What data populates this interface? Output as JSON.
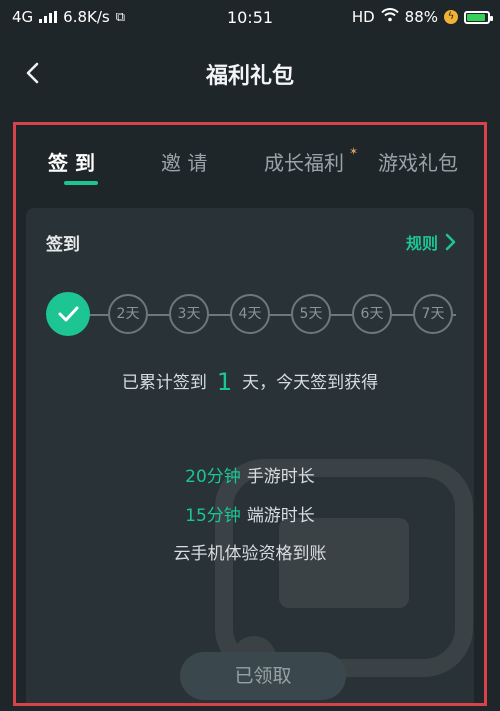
{
  "status_bar": {
    "network": "4G",
    "speed": "6.8K/s",
    "time": "10:51",
    "hd": "HD",
    "battery": "88%",
    "battery_level": 0.88
  },
  "header": {
    "title": "福利礼包"
  },
  "tabs": [
    {
      "label": "签 到",
      "active": true
    },
    {
      "label": "邀 请",
      "active": false
    },
    {
      "label": "成长福利",
      "active": false
    },
    {
      "label": "游戏礼包",
      "active": false
    }
  ],
  "signin": {
    "title": "签到",
    "rules_label": "规则",
    "days": [
      "2天",
      "3天",
      "4天",
      "5天",
      "6天",
      "7天"
    ],
    "summary_prefix": "已累计签到",
    "summary_count": "1",
    "summary_suffix": "天，今天签到获得",
    "rewards": [
      {
        "amount": "20分钟",
        "desc": "手游时长"
      },
      {
        "amount": "15分钟",
        "desc": "端游时长"
      }
    ],
    "extra_reward": "云手机体验资格到账",
    "claim_label": "已领取"
  },
  "colors": {
    "accent": "#1cc592",
    "background": "#1f2629",
    "card": "#293236",
    "highlight_frame": "#d8434b"
  }
}
